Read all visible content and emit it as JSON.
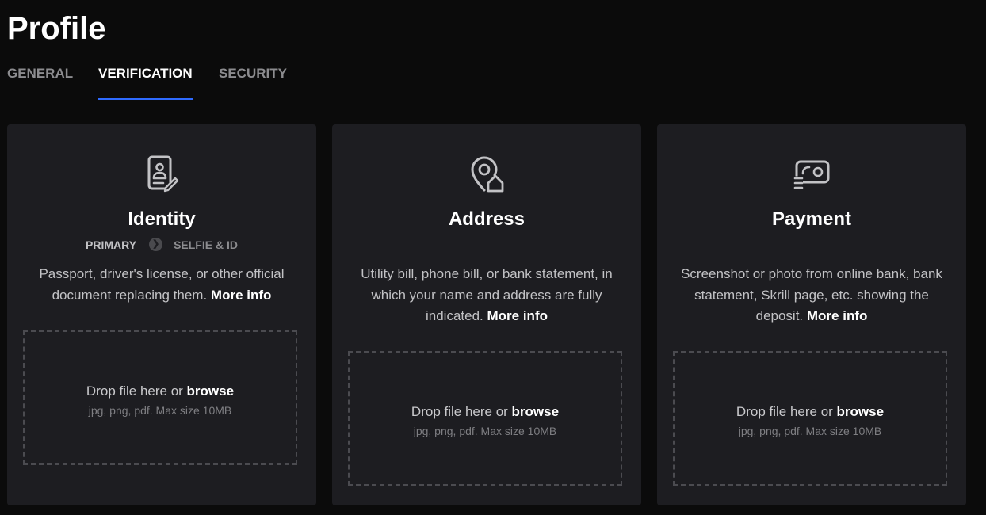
{
  "page": {
    "title": "Profile"
  },
  "tabs": [
    {
      "label": "GENERAL",
      "active": false
    },
    {
      "label": "VERIFICATION",
      "active": true
    },
    {
      "label": "SECURITY",
      "active": false
    }
  ],
  "accent_color": "#2f6bff",
  "cards": [
    {
      "icon": "id-document-icon",
      "title": "Identity",
      "steps": [
        "PRIMARY",
        "SELFIE & ID"
      ],
      "description": "Passport, driver's license, or other official document replacing them.",
      "more_info": "More info",
      "drop": {
        "text": "Drop file here or",
        "browse": "browse",
        "hint": "jpg, png, pdf. Max size 10MB"
      }
    },
    {
      "icon": "location-home-icon",
      "title": "Address",
      "description": "Utility bill, phone bill, or bank statement, in which your name and address are fully indicated.",
      "more_info": "More info",
      "drop": {
        "text": "Drop file here or",
        "browse": "browse",
        "hint": "jpg, png, pdf. Max size 10MB"
      }
    },
    {
      "icon": "payment-card-icon",
      "title": "Payment",
      "description": "Screenshot or photo from online bank, bank statement, Skrill page, etc. showing the deposit.",
      "more_info": "More info",
      "drop": {
        "text": "Drop file here or",
        "browse": "browse",
        "hint": "jpg, png, pdf. Max size 10MB"
      }
    }
  ]
}
